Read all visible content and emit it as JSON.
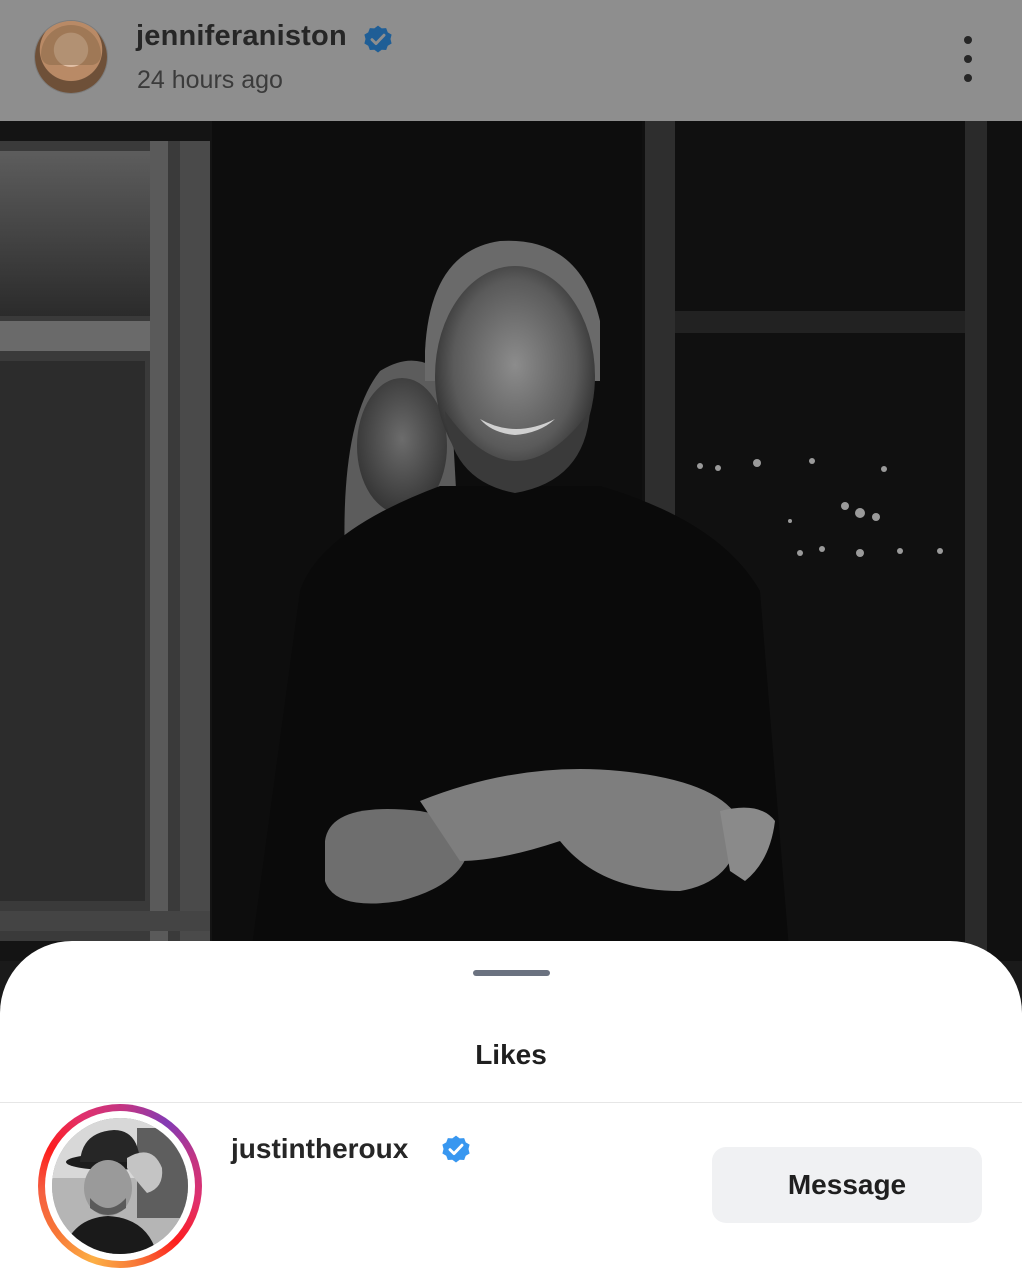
{
  "post_header": {
    "username": "jenniferaniston",
    "time_ago": "24 hours ago",
    "verified": true,
    "avatar_icon": "profile-avatar",
    "more_icon": "more-vertical-icon"
  },
  "likes_sheet": {
    "title": "Likes",
    "users": [
      {
        "username": "justintheroux",
        "verified": true,
        "has_story": true,
        "action_label": "Message"
      }
    ]
  },
  "colors": {
    "verified_badge": "#3897f0",
    "header_overlay": "#8e8e8e",
    "message_button_bg": "#f0f1f3",
    "story_ring_start": "#fcaf45",
    "story_ring_end": "#c13584"
  }
}
